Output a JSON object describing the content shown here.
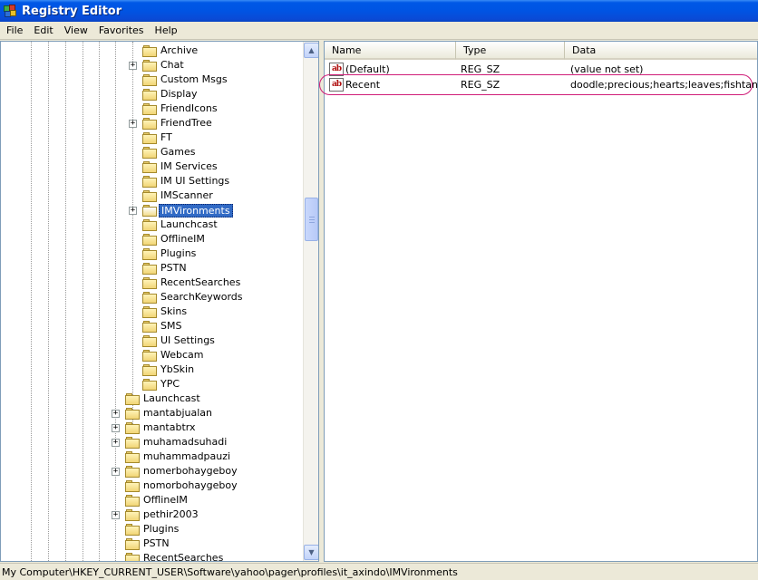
{
  "window": {
    "title": "Registry Editor"
  },
  "menu": [
    "File",
    "Edit",
    "View",
    "Favorites",
    "Help"
  ],
  "tree": {
    "selected": "IMVironments",
    "items": [
      {
        "label": "Archive",
        "level": 2,
        "expandable": false
      },
      {
        "label": "Chat",
        "level": 2,
        "expandable": true
      },
      {
        "label": "Custom Msgs",
        "level": 2,
        "expandable": false
      },
      {
        "label": "Display",
        "level": 2,
        "expandable": false
      },
      {
        "label": "FriendIcons",
        "level": 2,
        "expandable": false
      },
      {
        "label": "FriendTree",
        "level": 2,
        "expandable": true
      },
      {
        "label": "FT",
        "level": 2,
        "expandable": false
      },
      {
        "label": "Games",
        "level": 2,
        "expandable": false
      },
      {
        "label": "IM Services",
        "level": 2,
        "expandable": false
      },
      {
        "label": "IM UI Settings",
        "level": 2,
        "expandable": false
      },
      {
        "label": "IMScanner",
        "level": 2,
        "expandable": false
      },
      {
        "label": "IMVironments",
        "level": 2,
        "expandable": true,
        "selected": true
      },
      {
        "label": "Launchcast",
        "level": 2,
        "expandable": false
      },
      {
        "label": "OfflineIM",
        "level": 2,
        "expandable": false
      },
      {
        "label": "Plugins",
        "level": 2,
        "expandable": false
      },
      {
        "label": "PSTN",
        "level": 2,
        "expandable": false
      },
      {
        "label": "RecentSearches",
        "level": 2,
        "expandable": false
      },
      {
        "label": "SearchKeywords",
        "level": 2,
        "expandable": false
      },
      {
        "label": "Skins",
        "level": 2,
        "expandable": false
      },
      {
        "label": "SMS",
        "level": 2,
        "expandable": false
      },
      {
        "label": "UI Settings",
        "level": 2,
        "expandable": false
      },
      {
        "label": "Webcam",
        "level": 2,
        "expandable": false
      },
      {
        "label": "YbSkin",
        "level": 2,
        "expandable": false
      },
      {
        "label": "YPC",
        "level": 2,
        "expandable": false
      },
      {
        "label": "Launchcast",
        "level": 1,
        "expandable": false
      },
      {
        "label": "mantabjualan",
        "level": 1,
        "expandable": true
      },
      {
        "label": "mantabtrx",
        "level": 1,
        "expandable": true
      },
      {
        "label": "muhamadsuhadi",
        "level": 1,
        "expandable": true
      },
      {
        "label": "muhammadpauzi",
        "level": 1,
        "expandable": false
      },
      {
        "label": "nomerbohaygeboy",
        "level": 1,
        "expandable": true
      },
      {
        "label": "nomorbohaygeboy",
        "level": 1,
        "expandable": false
      },
      {
        "label": "OfflineIM",
        "level": 1,
        "expandable": false
      },
      {
        "label": "pethir2003",
        "level": 1,
        "expandable": true
      },
      {
        "label": "Plugins",
        "level": 1,
        "expandable": false
      },
      {
        "label": "PSTN",
        "level": 1,
        "expandable": false
      },
      {
        "label": "RecentSearches",
        "level": 1,
        "expandable": false
      }
    ]
  },
  "list": {
    "columns": [
      "Name",
      "Type",
      "Data"
    ],
    "icon": "ab",
    "rows": [
      {
        "name": "(Default)",
        "type": "REG_SZ",
        "data": "(value not set)"
      },
      {
        "name": "Recent",
        "type": "REG_SZ",
        "data": "doodle;precious;hearts;leaves;fishtank;",
        "highlighted": true
      }
    ]
  },
  "status": "My Computer\\HKEY_CURRENT_USER\\Software\\yahoo\\pager\\profiles\\it_axindo\\IMVironments",
  "colors": {
    "selection": "#316ac5",
    "highlight_oval": "#d01d78",
    "titlebar": "#0054e3"
  }
}
